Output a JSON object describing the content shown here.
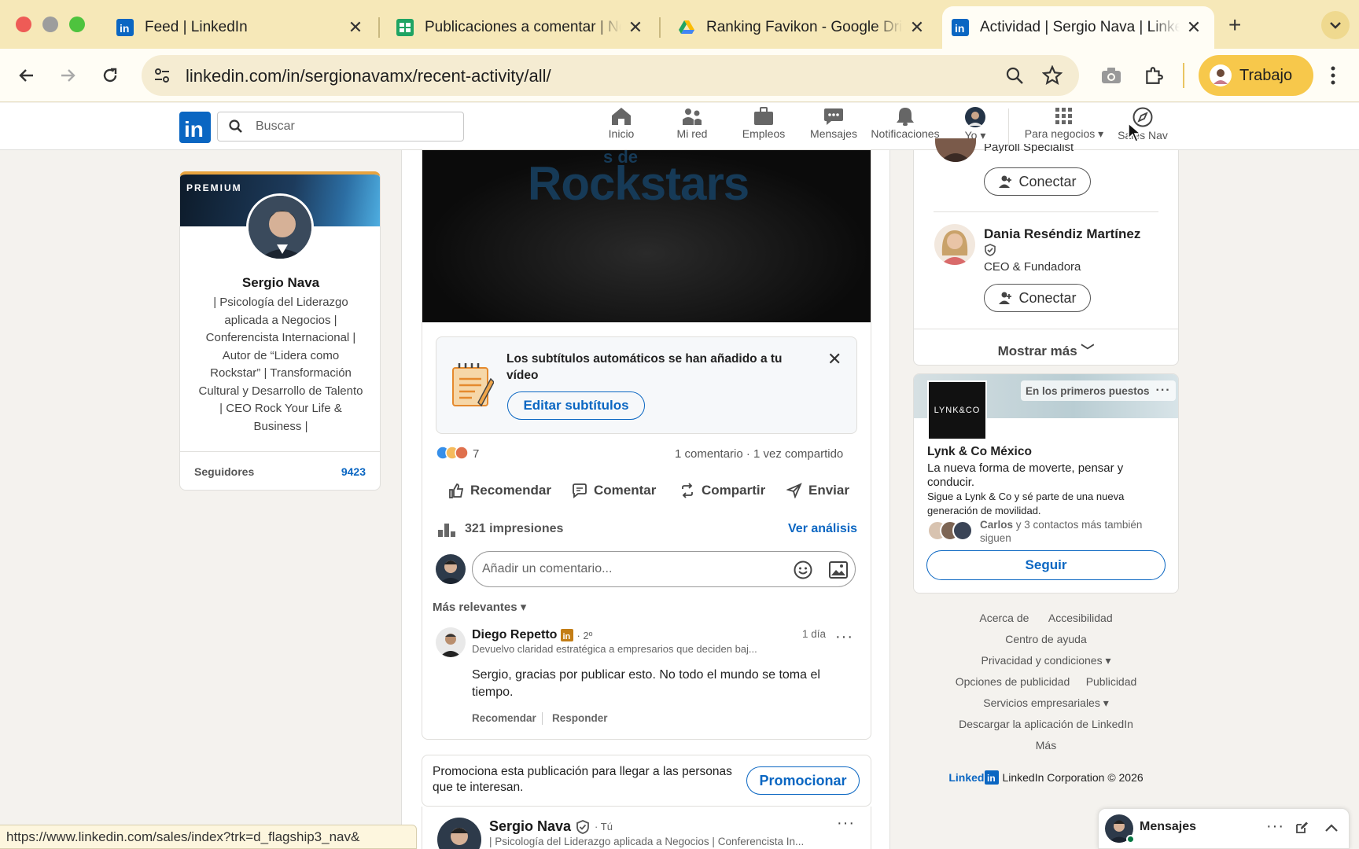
{
  "browser": {
    "tabs": [
      {
        "title": "Feed | LinkedIn",
        "icon": "linkedin-icon"
      },
      {
        "title": "Publicaciones a comentar | Notion",
        "icon": "sheets-icon"
      },
      {
        "title": "Ranking Favikon - Google Drive",
        "icon": "drive-icon"
      },
      {
        "title": "Actividad | Sergio Nava | LinkedIn",
        "icon": "linkedin-icon"
      }
    ],
    "url": "linkedin.com/in/sergionavamx/recent-activity/all/",
    "profile_label": "Trabajo",
    "status_url": "https://www.linkedin.com/sales/index?trk=d_flagship3_nav&"
  },
  "nav": {
    "search_placeholder": "Buscar",
    "items": [
      "Inicio",
      "Mi red",
      "Empleos",
      "Mensajes",
      "Notificaciones",
      "Yo",
      "Para negocios",
      "Sales Nav"
    ]
  },
  "profile_card": {
    "premium": "PREMIUM",
    "name": "Sergio Nava",
    "headline": "| Psicología del Liderazgo aplicada a Negocios | Conferencista Internacional | Autor de “Lidera como Rockstar” | Transformación Cultural y Desarrollo de Talento | CEO Rock Your Life & Business |",
    "followers_label": "Seguidores",
    "followers_count": "9423"
  },
  "post": {
    "video_text": "Rockstars",
    "video_text_small": "s de",
    "subtitle_notice": "Los subtítulos automáticos se han añadido a tu vídeo",
    "edit_subtitles": "Editar subtítulos",
    "reactions": "7",
    "stats": "1 comentario · 1 vez compartido",
    "actions": [
      "Recomendar",
      "Comentar",
      "Compartir",
      "Enviar"
    ],
    "impressions": "321 impresiones",
    "analytics": "Ver análisis",
    "comment_placeholder": "Añadir un comentario...",
    "sort": "Más relevantes",
    "comment": {
      "author": "Diego Repetto",
      "degree": "· 2º",
      "headline": "Devuelvo claridad estratégica a empresarios que deciden baj...",
      "time": "1 día",
      "text": "Sergio, gracias por publicar esto. No todo el mundo se toma el tiempo.",
      "like": "Recomendar",
      "reply": "Responder"
    }
  },
  "promo": {
    "text": "Promociona esta publicación para llegar a las personas que te interesan.",
    "button": "Promocionar"
  },
  "next_post": {
    "author": "Sergio Nava",
    "you": "· Tú",
    "headline": "| Psicología del Liderazgo aplicada a Negocios | Conferencista In..."
  },
  "suggestions": [
    {
      "title": "Payroll Specialist",
      "button": "Conectar"
    },
    {
      "name": "Dania Reséndiz Martínez",
      "title": "CEO & Fundadora",
      "button": "Conectar"
    }
  ],
  "show_more": "Mostrar más",
  "ad": {
    "badge": "En los primeros puestos",
    "logo_text": "LYNK&CO",
    "company": "Lynk & Co México",
    "tagline": "La nueva forma de moverte, pensar y conducir.",
    "desc": "Sigue a Lynk & Co y sé parte de una nueva generación de movilidad.",
    "contact_name": "Carlos",
    "contacts": "y 3 contactos más también siguen",
    "button": "Seguir"
  },
  "footer": {
    "links": [
      "Acerca de",
      "Accesibilidad",
      "Centro de ayuda",
      "Privacidad y condiciones",
      "Opciones de publicidad",
      "Publicidad",
      "Servicios empresariales",
      "Descargar la aplicación de LinkedIn",
      "Más"
    ],
    "brand": "Linked",
    "copyright": "LinkedIn Corporation © 2026"
  },
  "messaging": {
    "label": "Mensajes"
  }
}
